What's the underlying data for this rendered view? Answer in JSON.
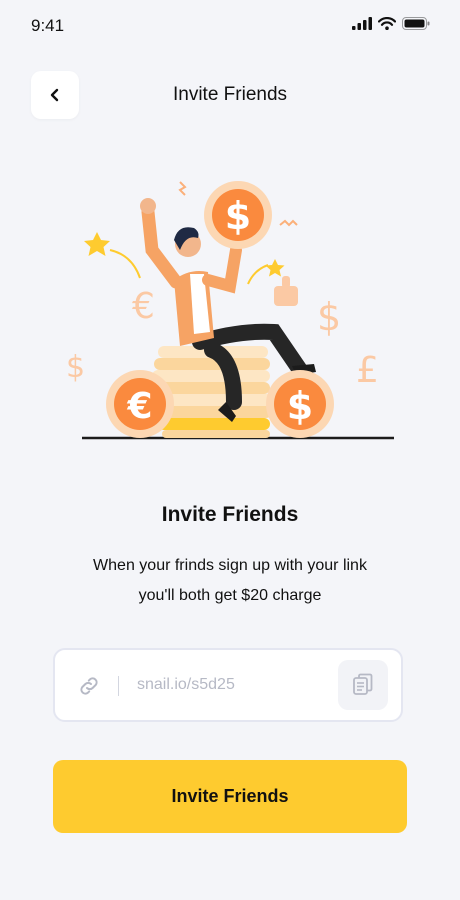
{
  "status_bar": {
    "time": "9:41"
  },
  "header": {
    "title": "Invite Friends",
    "back_icon": "chevron-left-icon"
  },
  "illustration": {
    "coin_symbols": [
      "$",
      "€",
      "$",
      "$",
      "€",
      "£",
      "$"
    ]
  },
  "content": {
    "heading": "Invite Friends",
    "description_line1": "When your frinds sign up with your link",
    "description_line2": "you'll both get $20 charge"
  },
  "referral": {
    "link": "snail.io/s5d25",
    "link_icon": "link-icon",
    "copy_icon": "copy-icon"
  },
  "cta": {
    "label": "Invite Friends"
  },
  "colors": {
    "accent": "#fecb2f",
    "coin": "#fa8a3e",
    "background": "#f4f5f9"
  }
}
